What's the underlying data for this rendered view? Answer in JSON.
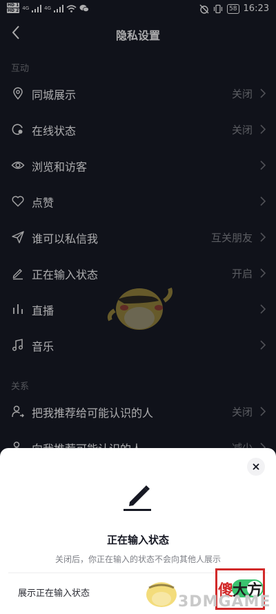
{
  "status_bar": {
    "hd1": "HD 1",
    "hd2": "HD 2",
    "signal1": "4G",
    "signal2": "4G",
    "battery": "58",
    "time": "16:23"
  },
  "nav": {
    "title": "隐私设置"
  },
  "sections": [
    {
      "header": "互动",
      "rows": [
        {
          "icon": "location-pin-icon",
          "label": "同城展示",
          "value": "关闭"
        },
        {
          "icon": "online-status-icon",
          "label": "在线状态",
          "value": "关闭"
        },
        {
          "icon": "eye-icon",
          "label": "浏览和访客",
          "value": ""
        },
        {
          "icon": "heart-icon",
          "label": "点赞",
          "value": ""
        },
        {
          "icon": "paper-plane-icon",
          "label": "谁可以私信我",
          "value": "互关朋友"
        },
        {
          "icon": "pen-icon",
          "label": "正在输入状态",
          "value": "开启"
        },
        {
          "icon": "live-bars-icon",
          "label": "直播",
          "value": ""
        },
        {
          "icon": "music-note-icon",
          "label": "音乐",
          "value": ""
        }
      ]
    },
    {
      "header": "关系",
      "rows": [
        {
          "icon": "person-share-icon",
          "label": "把我推荐给可能认识的人",
          "value": "关闭"
        },
        {
          "icon": "person-recommend-icon",
          "label": "向我推荐可能认识的人",
          "value": "减少"
        }
      ]
    }
  ],
  "sheet": {
    "title": "正在输入状态",
    "description": "关闭后，你正在输入的状态不会向其他人展示",
    "option_label": "展示正在输入状态",
    "toggle_on": true,
    "toggle_color": "#3bc36f"
  },
  "watermark": {
    "brand_red": "傻",
    "brand_black": "大方",
    "site": "3DMGAME"
  }
}
